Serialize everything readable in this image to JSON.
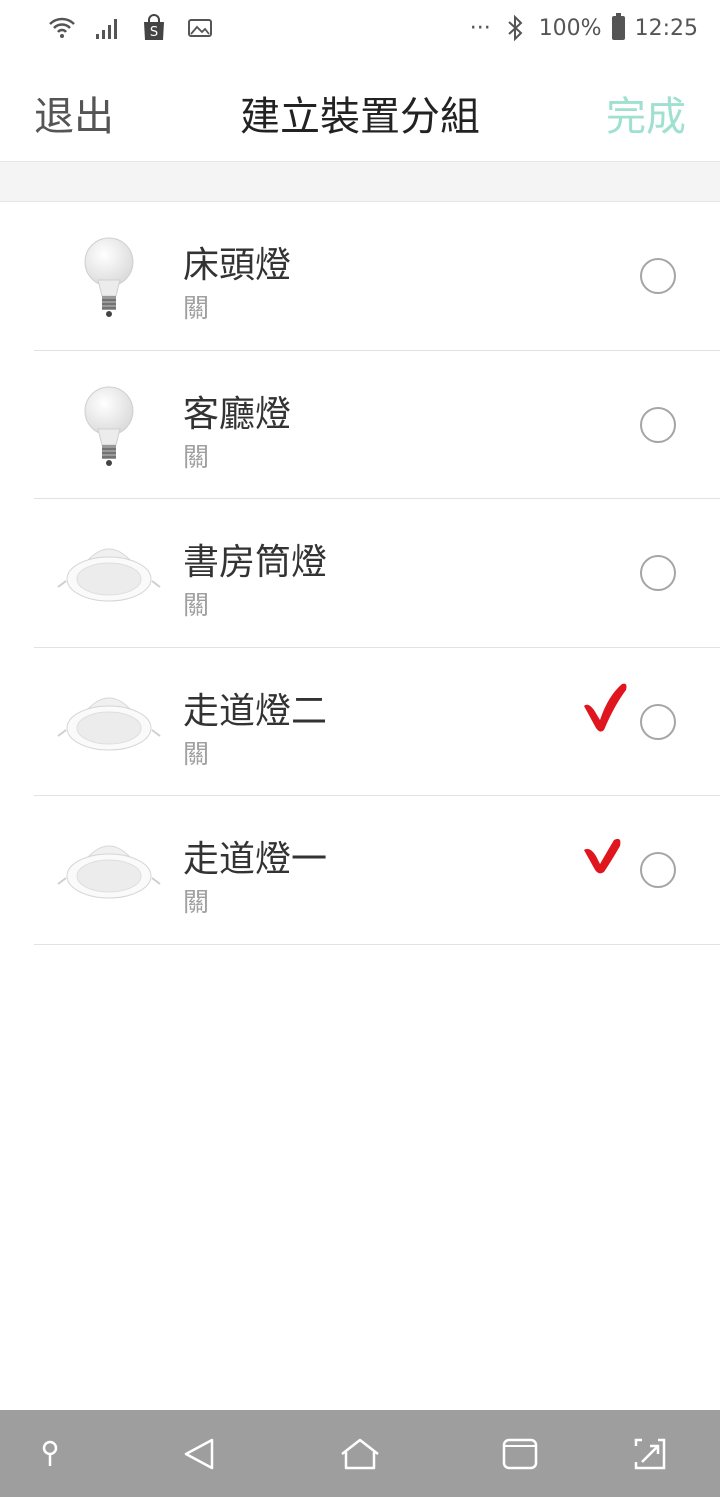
{
  "status_bar": {
    "left_icons": [
      "wifi-icon",
      "signal-icon",
      "shopping-bag-icon",
      "image-icon"
    ],
    "more": "···",
    "battery_percent": "100%",
    "time": "12:25"
  },
  "header": {
    "exit_label": "退出",
    "title": "建立裝置分組",
    "done_label": "完成"
  },
  "devices": [
    {
      "name": "床頭燈",
      "state": "關",
      "icon": "bulb-icon",
      "checked": false
    },
    {
      "name": "客廳燈",
      "state": "關",
      "icon": "bulb-icon",
      "checked": false
    },
    {
      "name": "書房筒燈",
      "state": "關",
      "icon": "downlight-icon",
      "checked": false
    },
    {
      "name": "走道燈二",
      "state": "關",
      "icon": "downlight-icon",
      "checked": true
    },
    {
      "name": "走道燈一",
      "state": "關",
      "icon": "downlight-icon",
      "checked": true
    }
  ],
  "nav_bar": {
    "icons": [
      "pin-icon",
      "back-icon",
      "home-icon",
      "recents-icon",
      "screenshot-icon"
    ]
  },
  "colors": {
    "done_accent": "#9fe0d0",
    "check_red": "#e0161e",
    "nav_bg": "#9e9e9e"
  }
}
